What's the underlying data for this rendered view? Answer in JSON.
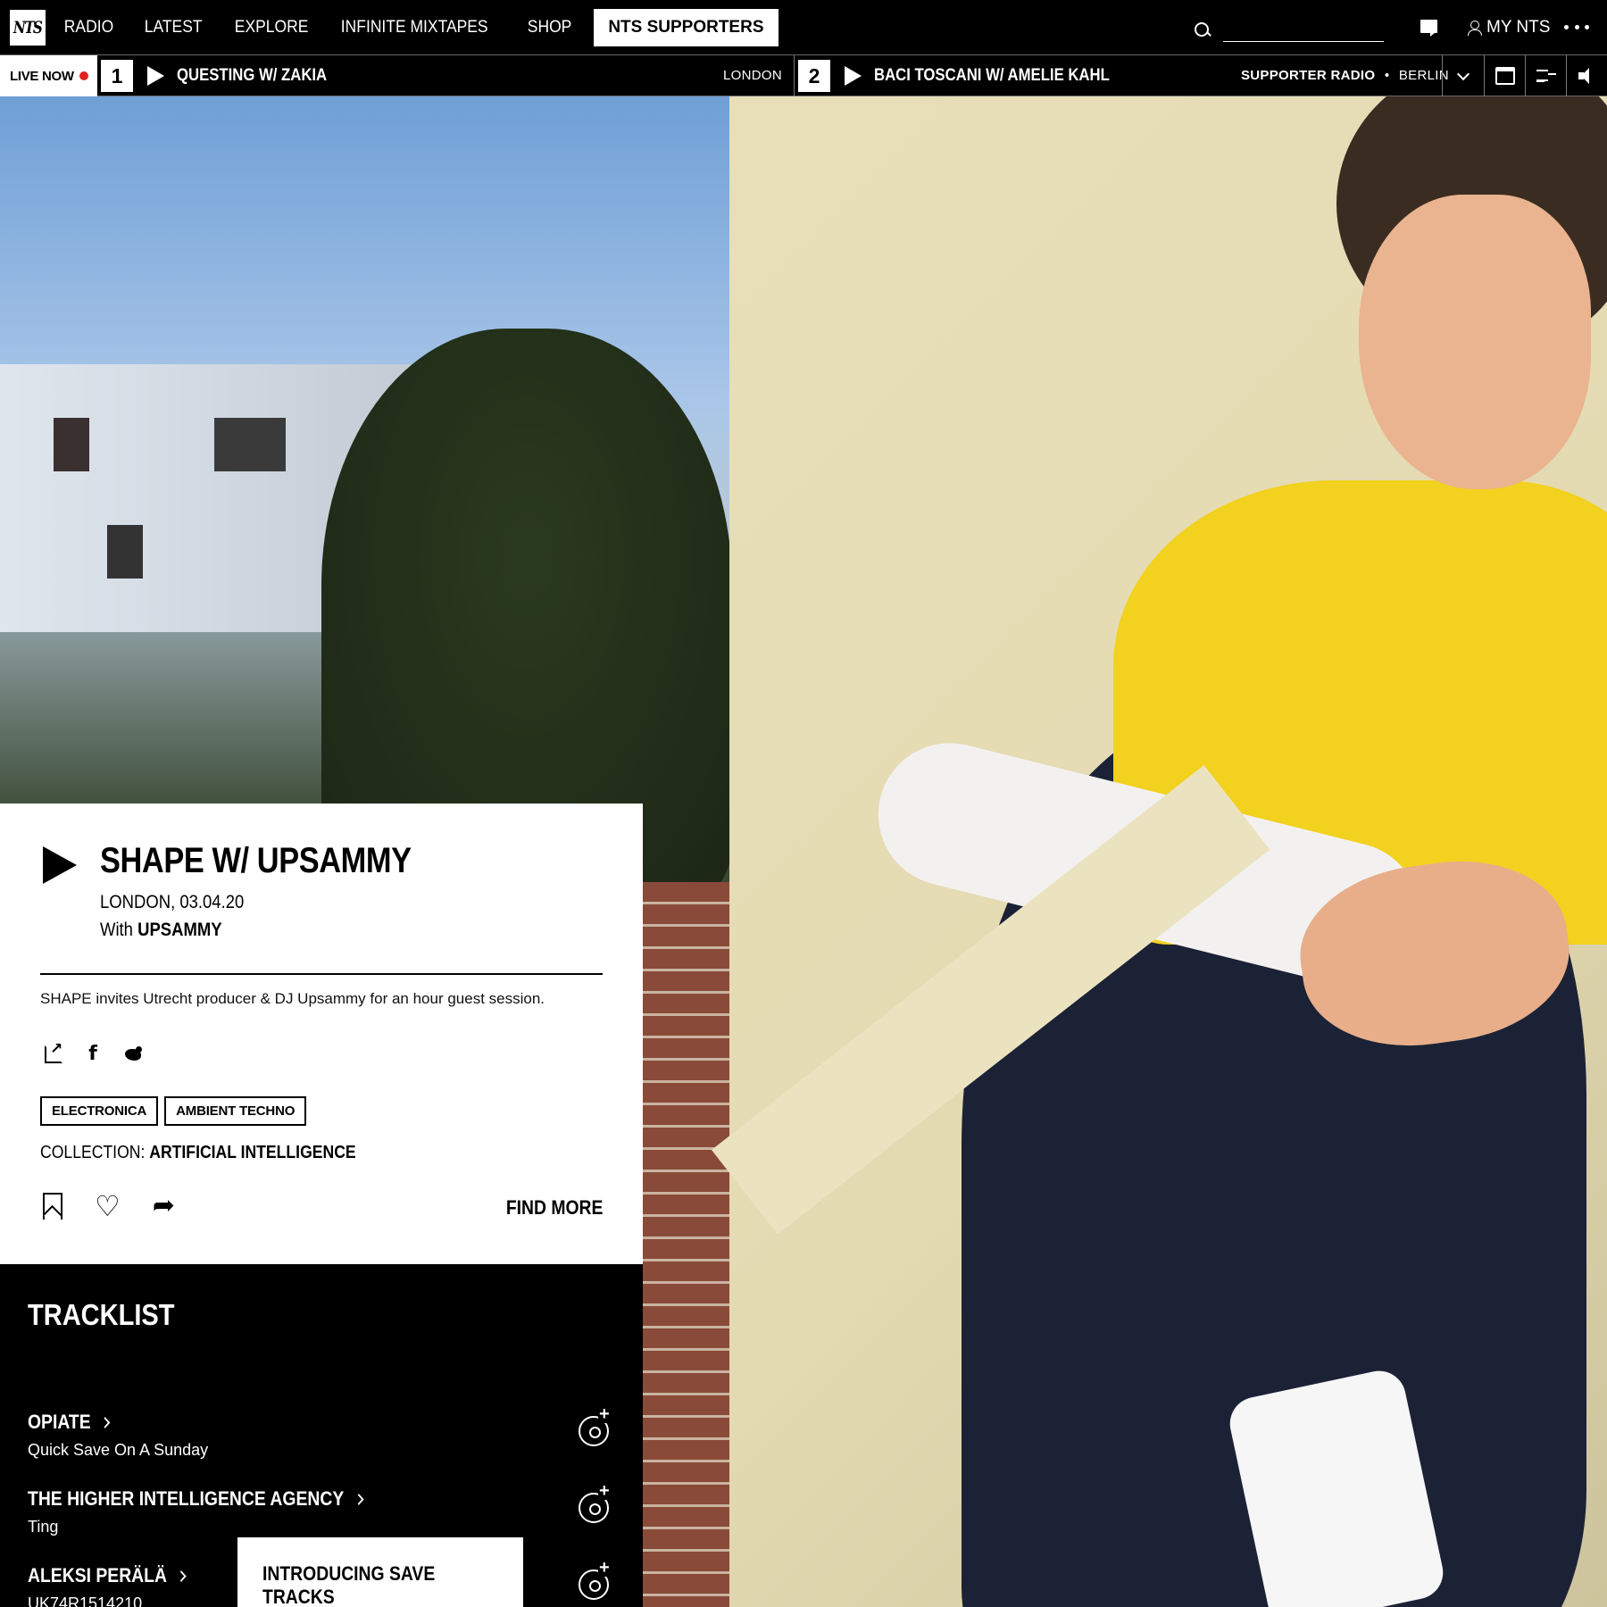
{
  "nav": {
    "logo": "NTS",
    "links": [
      "Radio",
      "Latest",
      "Explore",
      "Infinite Mixtapes",
      "Shop"
    ],
    "supporters": "NTS SUPPORTERS",
    "search_placeholder": "",
    "my_nts": "MY NTS"
  },
  "live": {
    "label": "LIVE NOW",
    "channel1": {
      "number": "1",
      "title": "QUESTING W/ ZAKIA",
      "location": "LONDON"
    },
    "channel2": {
      "number": "2",
      "title": "BACI TOSCANI W/ AMELIE KAHL",
      "label": "SUPPORTER RADIO",
      "separator": "•",
      "location": "BERLIN"
    }
  },
  "show": {
    "title": "SHAPE W/ UPSAMMY",
    "location_date": "LONDON, 03.04.20",
    "with_prefix": "With",
    "with_name": "UPSAMMY",
    "description": "SHAPE invites Utrecht producer & DJ Upsammy for an hour guest session.",
    "tags": [
      "ELECTRONICA",
      "AMBIENT TECHNO"
    ],
    "collection_label": "COLLECTION:",
    "collection_name": "ARTIFICIAL INTELLIGENCE",
    "find_more": "FIND MORE"
  },
  "tracklist": {
    "title": "TRACKLIST",
    "tracks": [
      {
        "artist": "OPIATE",
        "title": "Quick Save On A Sunday"
      },
      {
        "artist": "THE HIGHER INTELLIGENCE AGENCY",
        "title": "Ting"
      },
      {
        "artist": "ALEKSI PERÄLÄ",
        "title": "UK74R1514210"
      }
    ]
  },
  "popup": {
    "text": "INTRODUCING SAVE TRACKS"
  },
  "colors": {
    "live_dot": "#e02020",
    "background": "#000000",
    "card": "#ffffff"
  }
}
